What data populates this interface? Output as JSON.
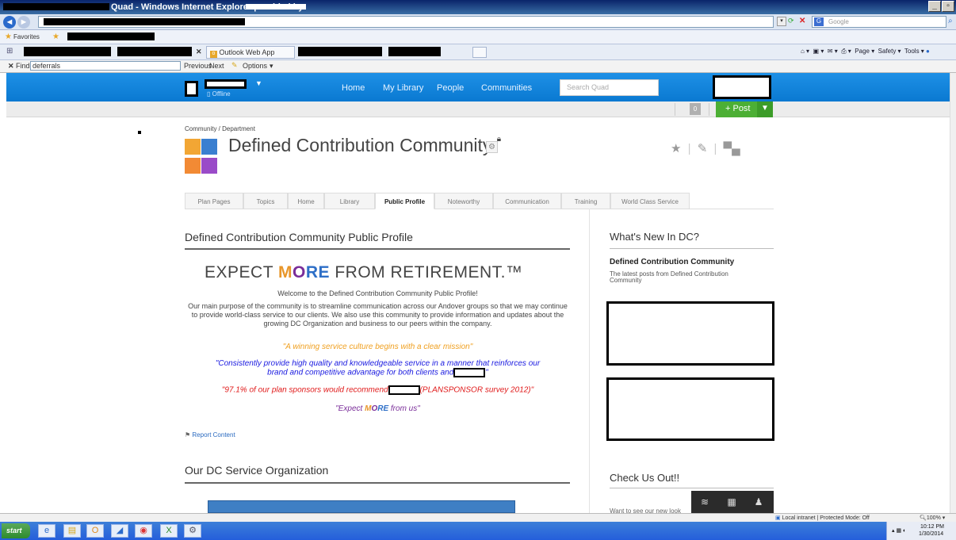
{
  "window": {
    "title": "Quad - Windows Internet Explorer provided by"
  },
  "browser": {
    "search_engine": "Google",
    "favorites_label": "Favorites",
    "tab_outlook": "Outlook Web App",
    "find_label": "Find:",
    "find_value": "deferrals",
    "previous": "Previous",
    "next": "Next",
    "options": "Options",
    "toolbar_items": [
      "Page ▾",
      "Safety ▾",
      "Tools ▾"
    ]
  },
  "quad": {
    "status": "Offline",
    "nav": [
      "Home",
      "My Library",
      "People",
      "Communities"
    ],
    "search_placeholder": "Search Quad",
    "notif_count": "0",
    "post_label": "+ Post"
  },
  "page": {
    "breadcrumb": "Community / Department",
    "title": "Defined Contribution Community",
    "tabs": [
      "Plan Pages",
      "Topics",
      "Home",
      "Library",
      "Public Profile",
      "Noteworthy",
      "Communication",
      "Training",
      "World Class Service"
    ],
    "active_tab": "Public Profile"
  },
  "main": {
    "section_title": "Defined Contribution Community Public Profile",
    "expect_pre": "EXPECT ",
    "expect_m": "M",
    "expect_o": "O",
    "expect_re": "RE",
    "expect_post": " FROM RETIREMENT.™",
    "welcome": "Welcome to the Defined Contribution Community Public Profile!",
    "purpose": "Our main purpose of the community is to streamline communication across our Andover groups so that we may continue to provide world-class service to our clients.  We also use this community to provide information and updates about the growing DC Organization and business to our peers within the company.",
    "quote1": "\"A winning service culture begins with a clear mission\"",
    "quote2a": "\"Consistently provide high quality and knowledgeable service in a manner that reinforces our",
    "quote2b": "brand and competitive advantage for both clients and",
    "quote2c": "\"",
    "quote3a": "\"97.1% of our plan sponsors would recommend",
    "quote3b": "(PLANSPONSOR survey 2012)\"",
    "quote4_pre": "\"Expect ",
    "quote4_m": "M",
    "quote4_o": "O",
    "quote4_re": "RE",
    "quote4_post": " from us\"",
    "report": "Report Content",
    "section2_title": "Our DC Service Organization"
  },
  "sidebar": {
    "news_title": "What's New In DC?",
    "news_heading": "Defined Contribution Community",
    "news_sub": "The latest posts from Defined Contribution Community",
    "check_title": "Check Us Out!!",
    "see_more": "Want to see our new look"
  },
  "status": {
    "zone": "Local intranet | Protected Mode: Off",
    "zoom": "100%"
  },
  "taskbar": {
    "start": "start",
    "time": "10:12 PM",
    "date": "1/30/2014"
  },
  "colors": {
    "nav_blue": "#0a79d1",
    "post_green": "#4caf34",
    "quote_orange": "#f0a020",
    "quote_blue": "#1a1ae0",
    "quote_red": "#e01a1a",
    "quote_purple": "#7a2d99"
  }
}
